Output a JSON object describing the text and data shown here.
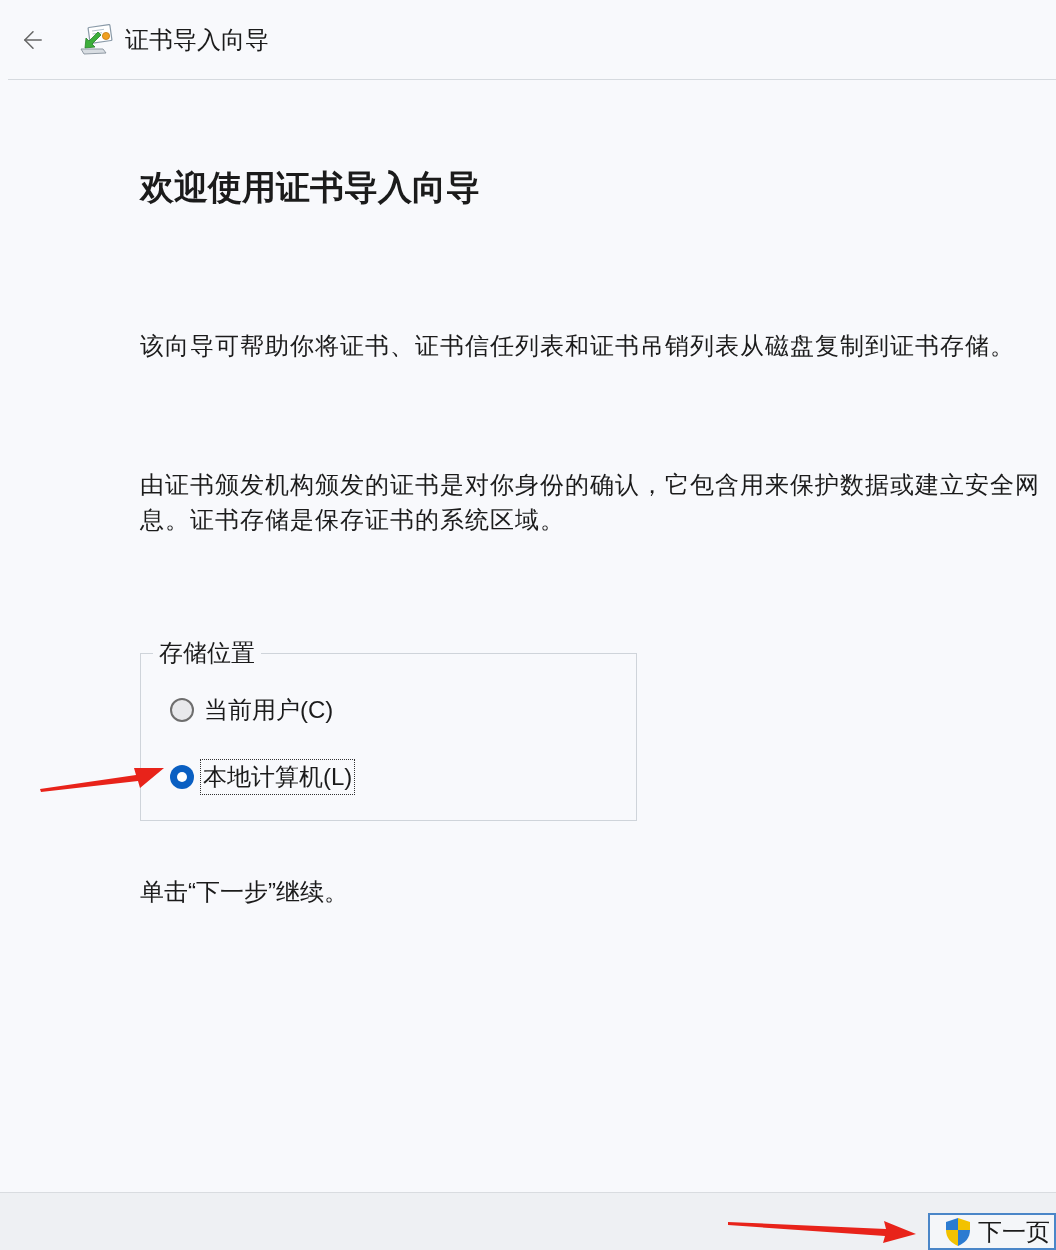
{
  "window": {
    "title": "证书导入向导"
  },
  "page": {
    "heading": "欢迎使用证书导入向导",
    "intro": "该向导可帮助你将证书、证书信任列表和证书吊销列表从磁盘复制到证书存储。",
    "description_lines": [
      "由证书颁发机构颁发的证书是对你身份的确认，它包含用来保护数据或建立安全网",
      "息。证书存储是保存证书的系统区域。"
    ]
  },
  "store_location": {
    "legend": "存储位置",
    "options": [
      {
        "label": "当前用户(C)",
        "selected": false,
        "focused": false
      },
      {
        "label": "本地计算机(L)",
        "selected": true,
        "focused": true
      }
    ]
  },
  "instruction": "单击“下一步”继续。",
  "footer": {
    "buttons": [
      {
        "label": "下一页",
        "shield": true
      }
    ]
  }
}
